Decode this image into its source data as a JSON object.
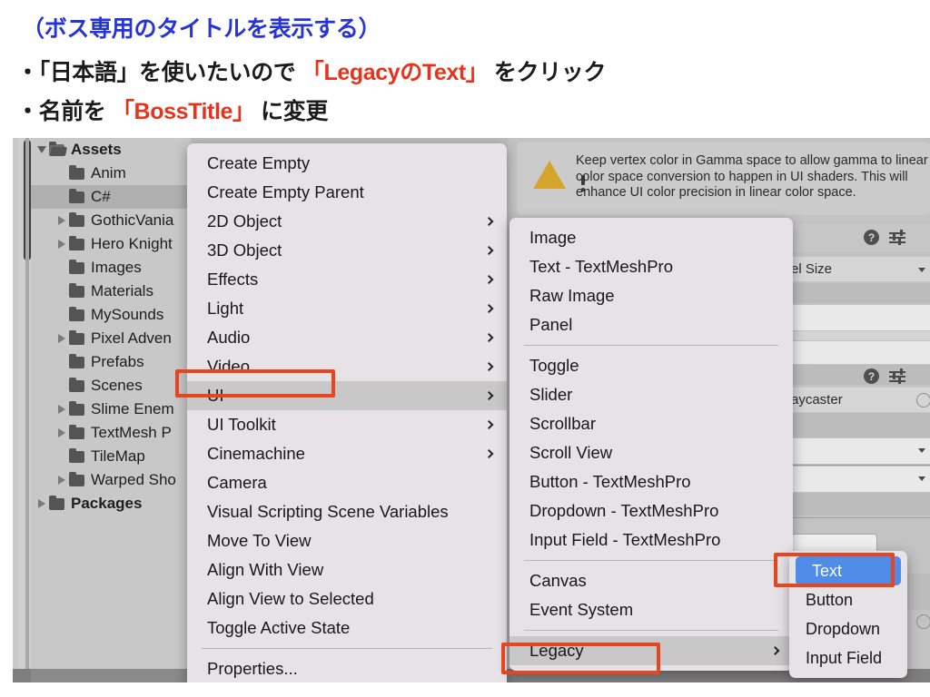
{
  "slide": {
    "title": "（ボス専用のタイトルを表示する）",
    "bullets": [
      {
        "prefix": "・「日本語」を使いたいので ",
        "highlight": "「LegacyのText」",
        "suffix": " をクリック"
      },
      {
        "prefix": "・名前を ",
        "highlight": "「BossTitle」",
        "suffix": " に変更"
      }
    ],
    "title_color": "#2633d6",
    "highlight_color": "#e8331c"
  },
  "project_tree": {
    "items": [
      {
        "label": "Assets",
        "indent": 0,
        "twisty": "down",
        "folder": "open",
        "bold": true,
        "selected": false
      },
      {
        "label": "Anim",
        "indent": 1,
        "twisty": "none",
        "folder": "closed",
        "bold": false,
        "selected": false
      },
      {
        "label": "C#",
        "indent": 1,
        "twisty": "none",
        "folder": "closed",
        "bold": false,
        "selected": true
      },
      {
        "label": "GothicVania",
        "indent": 1,
        "twisty": "right",
        "folder": "closed",
        "bold": false,
        "selected": false
      },
      {
        "label": "Hero Knight",
        "indent": 1,
        "twisty": "right",
        "folder": "closed",
        "bold": false,
        "selected": false
      },
      {
        "label": "Images",
        "indent": 1,
        "twisty": "none",
        "folder": "closed",
        "bold": false,
        "selected": false
      },
      {
        "label": "Materials",
        "indent": 1,
        "twisty": "none",
        "folder": "closed",
        "bold": false,
        "selected": false
      },
      {
        "label": "MySounds",
        "indent": 1,
        "twisty": "none",
        "folder": "closed",
        "bold": false,
        "selected": false
      },
      {
        "label": "Pixel Adven",
        "indent": 1,
        "twisty": "right",
        "folder": "closed",
        "bold": false,
        "selected": false
      },
      {
        "label": "Prefabs",
        "indent": 1,
        "twisty": "none",
        "folder": "closed",
        "bold": false,
        "selected": false
      },
      {
        "label": "Scenes",
        "indent": 1,
        "twisty": "none",
        "folder": "closed",
        "bold": false,
        "selected": false
      },
      {
        "label": "Slime Enem",
        "indent": 1,
        "twisty": "right",
        "folder": "closed",
        "bold": false,
        "selected": false
      },
      {
        "label": "TextMesh P",
        "indent": 1,
        "twisty": "right",
        "folder": "closed",
        "bold": false,
        "selected": false
      },
      {
        "label": "TileMap",
        "indent": 1,
        "twisty": "none",
        "folder": "closed",
        "bold": false,
        "selected": false
      },
      {
        "label": "Warped Sho",
        "indent": 1,
        "twisty": "right",
        "folder": "closed",
        "bold": false,
        "selected": false
      },
      {
        "label": "Packages",
        "indent": 0,
        "twisty": "right",
        "folder": "closed",
        "bold": true,
        "selected": false
      }
    ]
  },
  "inspector": {
    "warning": "Keep vertex color in Gamma space to allow gamma to linear color space conversion to happen in UI shaders. This will enhance UI color precision in linear color space.",
    "warning_icon": "warning-triangle-icon",
    "help_icon": "help-icon",
    "preset_icon": "preset-sliders-icon",
    "field_pixel_size": "el Size",
    "field_raycaster": "aycaster"
  },
  "context_menu": {
    "name": "create-menu",
    "items": [
      {
        "label": "Create Empty",
        "arrow": false,
        "highlighted": false,
        "separator_after": false
      },
      {
        "label": "Create Empty Parent",
        "arrow": false,
        "highlighted": false,
        "separator_after": false
      },
      {
        "label": "2D Object",
        "arrow": true,
        "highlighted": false,
        "separator_after": false
      },
      {
        "label": "3D Object",
        "arrow": true,
        "highlighted": false,
        "separator_after": false
      },
      {
        "label": "Effects",
        "arrow": true,
        "highlighted": false,
        "separator_after": false
      },
      {
        "label": "Light",
        "arrow": true,
        "highlighted": false,
        "separator_after": false
      },
      {
        "label": "Audio",
        "arrow": true,
        "highlighted": false,
        "separator_after": false
      },
      {
        "label": "Video",
        "arrow": true,
        "highlighted": false,
        "separator_after": false
      },
      {
        "label": "UI",
        "arrow": true,
        "highlighted": true,
        "separator_after": false
      },
      {
        "label": "UI Toolkit",
        "arrow": true,
        "highlighted": false,
        "separator_after": false
      },
      {
        "label": "Cinemachine",
        "arrow": true,
        "highlighted": false,
        "separator_after": false
      },
      {
        "label": "Camera",
        "arrow": false,
        "highlighted": false,
        "separator_after": false
      },
      {
        "label": "Visual Scripting Scene Variables",
        "arrow": false,
        "highlighted": false,
        "separator_after": false
      },
      {
        "label": "Move To View",
        "arrow": false,
        "highlighted": false,
        "separator_after": false
      },
      {
        "label": "Align With View",
        "arrow": false,
        "highlighted": false,
        "separator_after": false
      },
      {
        "label": "Align View to Selected",
        "arrow": false,
        "highlighted": false,
        "separator_after": false
      },
      {
        "label": "Toggle Active State",
        "arrow": false,
        "highlighted": false,
        "separator_after": true
      },
      {
        "label": "Properties...",
        "arrow": false,
        "highlighted": false,
        "separator_after": false
      }
    ]
  },
  "ui_submenu": {
    "name": "ui-submenu",
    "items": [
      {
        "label": "Image",
        "arrow": false,
        "highlighted": false,
        "separator_after": false
      },
      {
        "label": "Text - TextMeshPro",
        "arrow": false,
        "highlighted": false,
        "separator_after": false
      },
      {
        "label": "Raw Image",
        "arrow": false,
        "highlighted": false,
        "separator_after": false
      },
      {
        "label": "Panel",
        "arrow": false,
        "highlighted": false,
        "separator_after": true
      },
      {
        "label": "Toggle",
        "arrow": false,
        "highlighted": false,
        "separator_after": false
      },
      {
        "label": "Slider",
        "arrow": false,
        "highlighted": false,
        "separator_after": false
      },
      {
        "label": "Scrollbar",
        "arrow": false,
        "highlighted": false,
        "separator_after": false
      },
      {
        "label": "Scroll View",
        "arrow": false,
        "highlighted": false,
        "separator_after": false
      },
      {
        "label": "Button - TextMeshPro",
        "arrow": false,
        "highlighted": false,
        "separator_after": false
      },
      {
        "label": "Dropdown - TextMeshPro",
        "arrow": false,
        "highlighted": false,
        "separator_after": false
      },
      {
        "label": "Input Field - TextMeshPro",
        "arrow": false,
        "highlighted": false,
        "separator_after": true
      },
      {
        "label": "Canvas",
        "arrow": false,
        "highlighted": false,
        "separator_after": false
      },
      {
        "label": "Event System",
        "arrow": false,
        "highlighted": false,
        "separator_after": true
      },
      {
        "label": "Legacy",
        "arrow": true,
        "highlighted": true,
        "separator_after": false
      }
    ]
  },
  "legacy_submenu": {
    "name": "legacy-submenu",
    "items": [
      {
        "label": "Text",
        "arrow": false,
        "highlighted": false,
        "selected": true,
        "separator_after": false
      },
      {
        "label": "Button",
        "arrow": false,
        "highlighted": false,
        "selected": false,
        "separator_after": false
      },
      {
        "label": "Dropdown",
        "arrow": false,
        "highlighted": false,
        "selected": false,
        "separator_after": false
      },
      {
        "label": "Input Field",
        "arrow": false,
        "highlighted": false,
        "selected": false,
        "separator_after": false
      }
    ]
  },
  "annotations": {
    "color": "#e8441f",
    "boxes": [
      "ui-menu-item",
      "legacy-menu-item",
      "text-menu-item"
    ]
  }
}
